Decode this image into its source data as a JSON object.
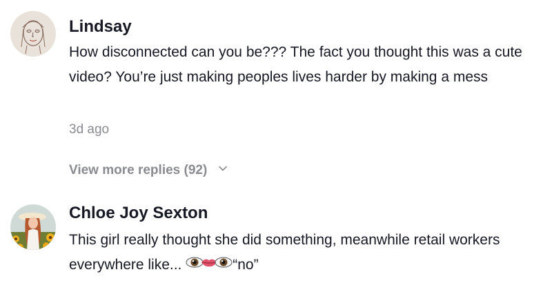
{
  "comments": [
    {
      "username": "Lindsay",
      "avatar_icon": "sketch-face-avatar",
      "text": "How disconnected can you be??? The fact you thought this was a cute video? You’re just making peoples lives harder by making a mess",
      "timestamp": "3d ago",
      "view_more_replies": "View more replies (92)"
    },
    {
      "username": "Chloe Joy Sexton",
      "avatar_icon": "photo-avatar-sunflowers",
      "text": "This girl really thought she did something, meanwhile retail workers everywhere like...",
      "text_suffix": "“no”",
      "emoji_icons": [
        "eye-icon",
        "lips-icon",
        "eye-icon"
      ]
    }
  ],
  "colors": {
    "primary_text": "#161823",
    "secondary_text": "#8a8b91"
  }
}
